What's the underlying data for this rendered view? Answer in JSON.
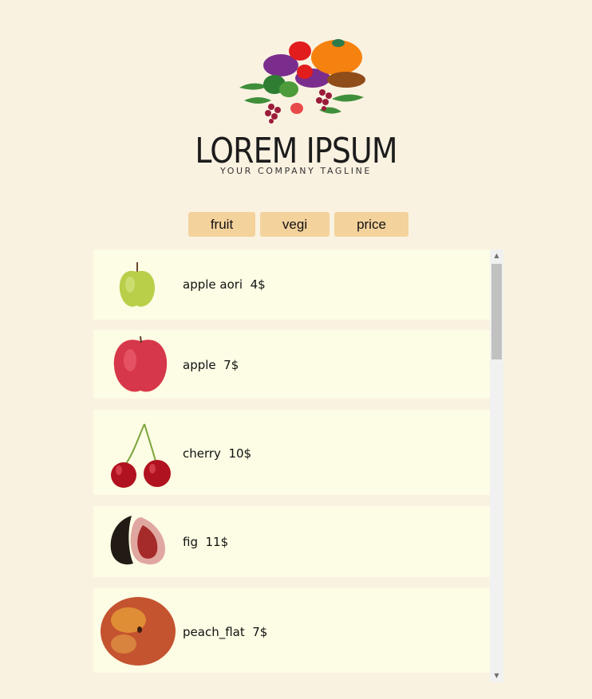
{
  "logo": {
    "title": "LOREM IPSUM",
    "tagline": "YOUR COMPANY TAGLINE"
  },
  "filters": [
    "fruit",
    "vegi",
    "price"
  ],
  "products": [
    {
      "name": "apple aori",
      "price": "4$",
      "label": "apple aori  4$",
      "image": "green-apple"
    },
    {
      "name": "apple",
      "price": "7$",
      "label": "apple  7$",
      "image": "red-apple"
    },
    {
      "name": "cherry",
      "price": "10$",
      "label": "cherry  10$",
      "image": "cherries"
    },
    {
      "name": "fig",
      "price": "11$",
      "label": "fig  11$",
      "image": "fig"
    },
    {
      "name": "peach_flat",
      "price": "7$",
      "label": "peach_flat  7$",
      "image": "flat-peach"
    }
  ],
  "colors": {
    "page_bg": "#faf2e1",
    "card_bg": "#fdfce4",
    "button_bg": "#f4d29c"
  }
}
